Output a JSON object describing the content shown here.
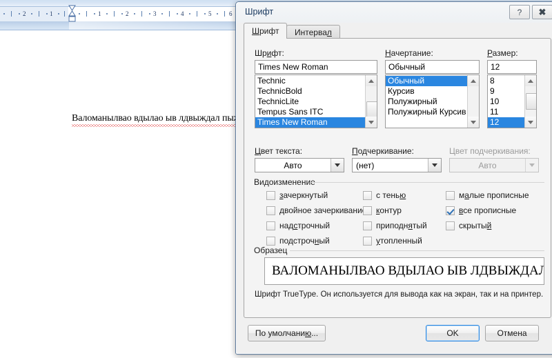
{
  "background": {
    "app": "word-document",
    "ruler": {
      "marks_left": [
        "2",
        "1"
      ],
      "marks_right": [
        "1",
        "2",
        "3",
        "4",
        "5",
        "6"
      ]
    },
    "document_text": "Валоманылвао вдылао ыв лдвыждал пыжвда",
    "spellcheck_underline": true
  },
  "dialog": {
    "title": "Шрифт",
    "help_button": "?",
    "close_button": "✕",
    "tabs": [
      {
        "label": "Шрифт",
        "accel": "Ш",
        "active": true
      },
      {
        "label": "Интервал",
        "accel": "л",
        "active": false
      }
    ],
    "font": {
      "label": "Шрифт:",
      "label_accel": "и",
      "value": "Times New Roman",
      "items": [
        "Technic",
        "TechnicBold",
        "TechnicLite",
        "Tempus Sans ITC",
        "Times New Roman"
      ],
      "selected_index": 4
    },
    "style": {
      "label": "Начертание:",
      "label_accel": "Н",
      "value": "Обычный",
      "items": [
        "Обычный",
        "Курсив",
        "Полужирный",
        "Полужирный Курсив"
      ],
      "selected_index": 0
    },
    "size": {
      "label": "Размер:",
      "label_accel": "Р",
      "value": "12",
      "items": [
        "8",
        "9",
        "10",
        "11",
        "12"
      ],
      "selected_index": 4
    },
    "text_color": {
      "label": "Цвет текста:",
      "label_accel": "Ц",
      "value": "Авто",
      "disabled": false
    },
    "underline_style": {
      "label": "Подчеркивание:",
      "label_accel": "П",
      "value": "(нет)",
      "disabled": false
    },
    "underline_color": {
      "label": "Цвет подчеркивания:",
      "value": "Авто",
      "disabled": true
    },
    "effects": {
      "group_title": "Видоизменение",
      "columns": [
        [
          {
            "label": "зачеркнутый",
            "accel": "з",
            "checked": false
          },
          {
            "label": "двойное зачеркивание",
            "accel": "д",
            "checked": false
          },
          {
            "label": "надстрочный",
            "accel": "с",
            "checked": false
          },
          {
            "label": "подстрочный",
            "accel": "н",
            "checked": false
          }
        ],
        [
          {
            "label": "с тенью",
            "accel": "ю",
            "checked": false
          },
          {
            "label": "контур",
            "accel": "к",
            "checked": false
          },
          {
            "label": "приподнятый",
            "accel": "я",
            "checked": false
          },
          {
            "label": "утопленный",
            "accel": "у",
            "checked": false
          }
        ],
        [
          {
            "label": "малые прописные",
            "accel": "а",
            "checked": false
          },
          {
            "label": "все прописные",
            "accel": "в",
            "checked": true
          },
          {
            "label": "скрытый",
            "accel": "й",
            "checked": false
          }
        ]
      ]
    },
    "sample": {
      "group_title": "Образец",
      "preview_text": "ВАЛОМАНЫЛВАО ВДЫЛАО ЫВ ЛДВЫЖДАЛ ПЫЖВДА",
      "note": "Шрифт TrueType. Он используется для вывода как на экран, так и на принтер."
    },
    "buttons": {
      "default": "По умолчанию...",
      "default_accel": "ю",
      "ok": "OK",
      "cancel": "Отмена"
    },
    "colors": {
      "selection": "#2a86e0",
      "title_text": "#1b3a60",
      "dialog_bg": "#f0f0f0",
      "spell_error": "#e03b3b"
    }
  }
}
